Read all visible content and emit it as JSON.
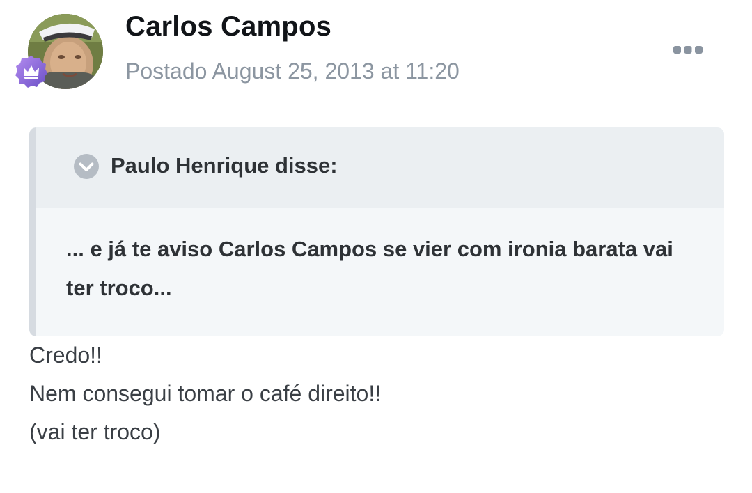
{
  "post": {
    "author": {
      "name": "Carlos Campos",
      "avatar_icon": "user-avatar-photo",
      "badge_icon": "crown-rank-badge",
      "badge_color": "#8e6ad8"
    },
    "date": "Postado August 25, 2013 at 11:20",
    "menu_icon": "more-options-icon",
    "quote": {
      "author_line": "Paulo Henrique disse:",
      "toggle_icon": "chevron-down-icon",
      "content": "... e já te aviso Carlos Campos se vier com ironia barata vai ter troco..."
    },
    "body": {
      "lines": [
        "Credo!!",
        "Nem consegui tomar o café direito!!",
        "(vai ter troco)"
      ]
    }
  },
  "colors": {
    "name": "#111418",
    "date": "#8c96a1",
    "quote_background": "#f4f7f9",
    "quote_header_background": "#ebeff2",
    "quote_bar": "#d6dbe1",
    "body_text": "#3a3f45"
  }
}
